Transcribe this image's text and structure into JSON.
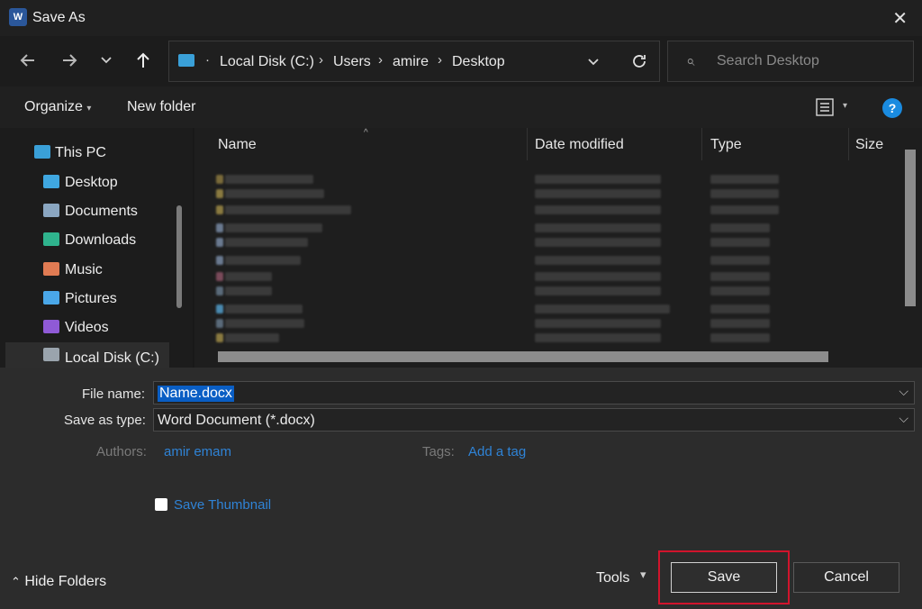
{
  "window": {
    "title": "Save As",
    "app_icon_letter": "W"
  },
  "nav": {
    "back_icon": "arrow-left-icon",
    "forward_icon": "arrow-right-icon",
    "recent_icon": "chevron-down-icon",
    "up_icon": "arrow-up-icon",
    "breadcrumbs": [
      "Local Disk (C:)",
      "Users",
      "amire",
      "Desktop"
    ],
    "search_placeholder": "Search Desktop"
  },
  "commands": {
    "organize": "Organize",
    "new_folder": "New folder",
    "help": "?"
  },
  "sidebar": {
    "items": [
      {
        "label": "This PC",
        "icon": "computer-icon",
        "color": "#3aa0d8"
      },
      {
        "label": "Desktop",
        "icon": "desktop-folder-icon",
        "color": "#3fa7e0"
      },
      {
        "label": "Documents",
        "icon": "documents-folder-icon",
        "color": "#8aa6c1"
      },
      {
        "label": "Downloads",
        "icon": "downloads-folder-icon",
        "color": "#2fb38d"
      },
      {
        "label": "Music",
        "icon": "music-folder-icon",
        "color": "#e07b53"
      },
      {
        "label": "Pictures",
        "icon": "pictures-folder-icon",
        "color": "#4aa7e8"
      },
      {
        "label": "Videos",
        "icon": "videos-folder-icon",
        "color": "#8f5ad6"
      },
      {
        "label": "Local Disk (C:)",
        "icon": "drive-icon",
        "color": "#9aa4ad"
      }
    ]
  },
  "columns": {
    "name": "Name",
    "date": "Date modified",
    "type": "Type",
    "size": "Size"
  },
  "form": {
    "file_name_label": "File name:",
    "file_name_value": "Name.docx",
    "save_type_label": "Save as type:",
    "save_type_value": "Word Document (*.docx)",
    "authors_label": "Authors:",
    "authors_value": "amir emam",
    "tags_label": "Tags:",
    "tags_value": "Add a tag",
    "thumbnail_label": "Save Thumbnail"
  },
  "footer": {
    "hide_folders": "Hide Folders",
    "tools": "Tools",
    "save": "Save",
    "cancel": "Cancel"
  },
  "colors": {
    "accent": "#2f83d6",
    "selection": "#0a5ec4",
    "highlight": "#d1142c"
  }
}
